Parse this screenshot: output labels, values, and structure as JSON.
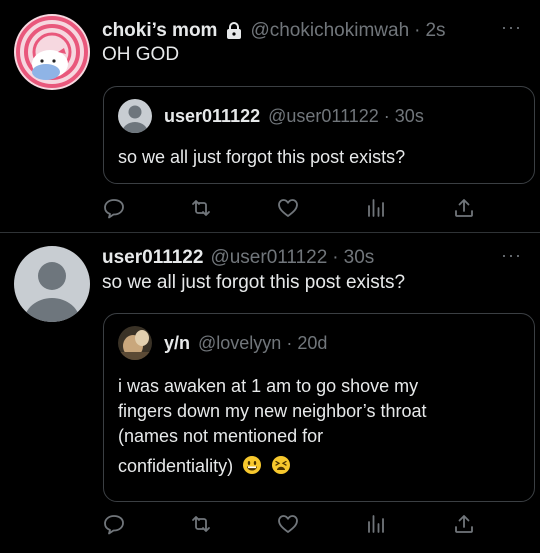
{
  "colors": {
    "background": "#000000",
    "text": "#e7e9ea",
    "muted": "#71767b",
    "border": "#3b3f43"
  },
  "tweets": [
    {
      "author": {
        "name": "choki’s mom",
        "handle": "@chokichokimwah",
        "locked": true,
        "avatar": "hello-kitty-avatar"
      },
      "time": "2s",
      "text": "OH GOD",
      "more": "···",
      "quote": {
        "author": {
          "name": "user011122",
          "handle": "@user011122",
          "avatar": "default-user-avatar"
        },
        "time": "30s",
        "text": "so we all just forgot this post exists?"
      },
      "actions": [
        "reply-icon",
        "retweet-icon",
        "like-icon",
        "analytics-icon",
        "share-icon"
      ]
    },
    {
      "author": {
        "name": "user011122",
        "handle": "@user011122",
        "locked": false,
        "avatar": "default-user-avatar"
      },
      "time": "30s",
      "text": "so we all just forgot this post exists?",
      "more": "···",
      "quote": {
        "author": {
          "name": "y/n",
          "handle": "@lovelyyn",
          "avatar": "photo-avatar"
        },
        "time": "20d",
        "text_lines": [
          "i was awaken at 1 am to go shove my",
          "fingers down my new neighbor’s throat",
          "(names not mentioned for",
          "confidentiality)"
        ],
        "emojis": [
          "grinning-face-emoji",
          "tired-face-emoji"
        ]
      },
      "actions": [
        "reply-icon",
        "retweet-icon",
        "like-icon",
        "analytics-icon",
        "share-icon"
      ]
    }
  ]
}
